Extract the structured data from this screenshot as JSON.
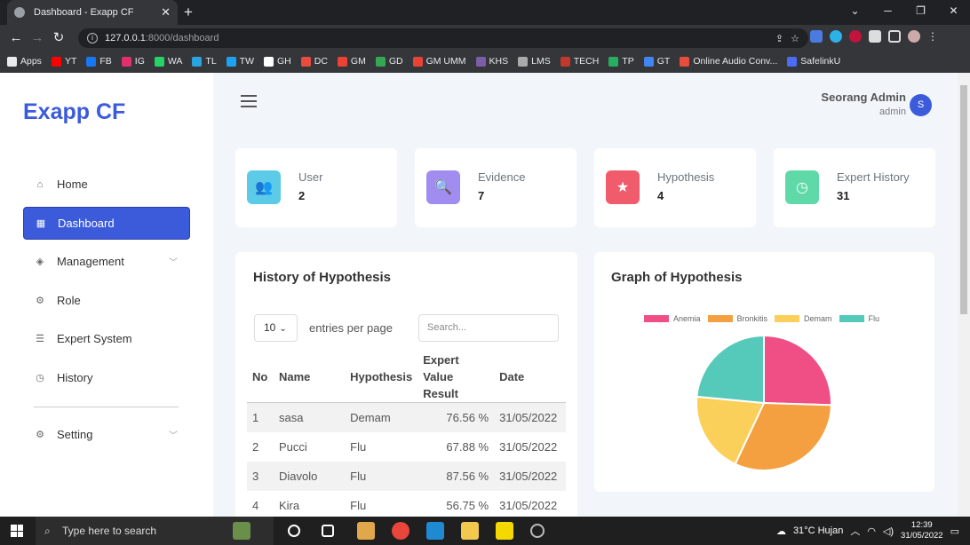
{
  "browser": {
    "tab_title": "Dashboard - Exapp CF",
    "url_host": "127.0.0.1",
    "url_path": ":8000/dashboard",
    "bookmarks": [
      {
        "label": "Apps",
        "color": "#e8eaed"
      },
      {
        "label": "YT",
        "color": "#ff0000"
      },
      {
        "label": "FB",
        "color": "#1877f2"
      },
      {
        "label": "IG",
        "color": "#e1306c"
      },
      {
        "label": "WA",
        "color": "#25d366"
      },
      {
        "label": "TL",
        "color": "#2aa3e0"
      },
      {
        "label": "TW",
        "color": "#1da1f2"
      },
      {
        "label": "GH",
        "color": "#ffffff"
      },
      {
        "label": "DC",
        "color": "#e74c3c"
      },
      {
        "label": "GM",
        "color": "#ea4335"
      },
      {
        "label": "GD",
        "color": "#34a853"
      },
      {
        "label": "GM UMM",
        "color": "#ea4335"
      },
      {
        "label": "KHS",
        "color": "#7b5ea7"
      },
      {
        "label": "LMS",
        "color": "#aaaaaa"
      },
      {
        "label": "TECH",
        "color": "#c0392b"
      },
      {
        "label": "TP",
        "color": "#27ae60"
      },
      {
        "label": "GT",
        "color": "#4285f4"
      },
      {
        "label": "Online Audio Conv...",
        "color": "#e74c3c"
      },
      {
        "label": "SafelinkU",
        "color": "#4a6cf7"
      }
    ]
  },
  "app": {
    "logo": "Exapp CF",
    "nav": [
      {
        "label": "Home",
        "icon": "home-icon",
        "glyph": "⌂",
        "active": false,
        "chevron": false
      },
      {
        "label": "Dashboard",
        "icon": "grid-icon",
        "glyph": "▦",
        "active": true,
        "chevron": false
      },
      {
        "label": "Management",
        "icon": "layers-icon",
        "glyph": "◈",
        "active": false,
        "chevron": true
      },
      {
        "label": "Role",
        "icon": "settings-cog-icon",
        "glyph": "⚙",
        "active": false,
        "chevron": false
      },
      {
        "label": "Expert System",
        "icon": "list-icon",
        "glyph": "☰",
        "active": false,
        "chevron": false
      },
      {
        "label": "History",
        "icon": "clock-icon",
        "glyph": "◷",
        "active": false,
        "chevron": false
      }
    ],
    "setting_label": "Setting",
    "user": {
      "name": "Seorang Admin",
      "role": "admin",
      "initial": "S"
    }
  },
  "stats": [
    {
      "label": "User",
      "value": "2",
      "color": "#5bcbe8",
      "icon": "users-icon",
      "glyph": "👥"
    },
    {
      "label": "Evidence",
      "value": "7",
      "color": "#a18cf0",
      "icon": "search-icon",
      "glyph": "🔍"
    },
    {
      "label": "Hypothesis",
      "value": "4",
      "color": "#f15c6c",
      "icon": "star-icon",
      "glyph": "★"
    },
    {
      "label": "Expert History",
      "value": "31",
      "color": "#5fd9a8",
      "icon": "clock-icon",
      "glyph": "◷"
    }
  ],
  "history": {
    "title": "History of Hypothesis",
    "per_page": "10",
    "per_page_label": "entries per page",
    "search_placeholder": "Search...",
    "columns": [
      "No",
      "Name",
      "Hypothesis",
      "Expert Value Result",
      "Date"
    ],
    "rows": [
      [
        "1",
        "sasa",
        "Demam",
        "76.56 %",
        "31/05/2022"
      ],
      [
        "2",
        "Pucci",
        "Flu",
        "67.88 %",
        "31/05/2022"
      ],
      [
        "3",
        "Diavolo",
        "Flu",
        "87.56 %",
        "31/05/2022"
      ],
      [
        "4",
        "Kira",
        "Flu",
        "56.75 %",
        "31/05/2022"
      ]
    ]
  },
  "graph": {
    "title": "Graph of Hypothesis"
  },
  "chart_data": {
    "type": "pie",
    "title": "Graph of Hypothesis",
    "labels": [
      "Anemia",
      "Bronkitis",
      "Demam",
      "Flu"
    ],
    "values": [
      25.5,
      31.5,
      19.5,
      23.5
    ],
    "colors": [
      "#ef4f84",
      "#f4a041",
      "#fbd05a",
      "#55c9ba"
    ],
    "legend": "top"
  },
  "taskbar": {
    "search_placeholder": "Type here to search",
    "weather": "31°C  Hujan",
    "time": "12:39",
    "date": "31/05/2022"
  }
}
